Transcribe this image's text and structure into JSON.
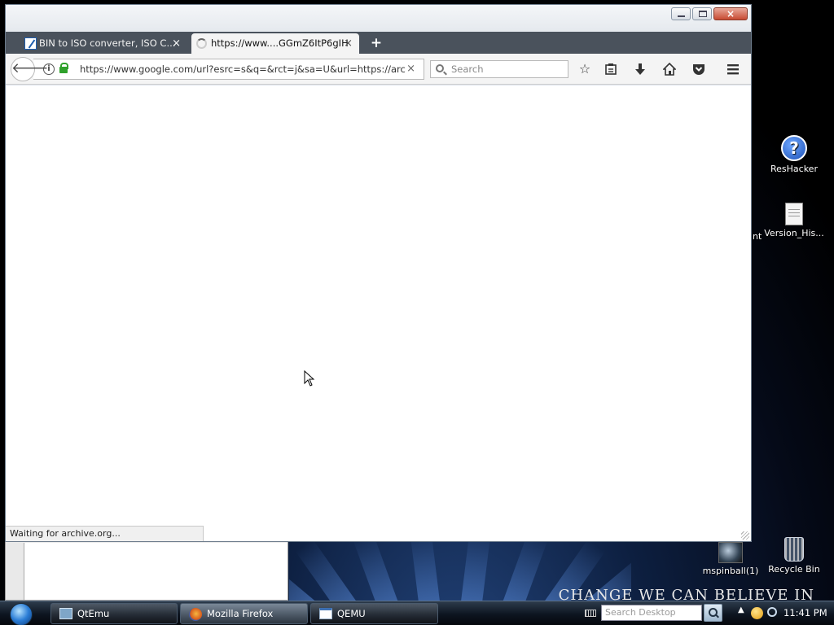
{
  "browser": {
    "tabs": [
      {
        "label": "BIN to ISO converter, ISO C...",
        "close": "×",
        "favicon": "bin-to-iso-favicon-icon"
      },
      {
        "label": "https://www....GGmZ6ItP6gIH",
        "close": "×",
        "favicon": "loading-spinner-icon"
      }
    ],
    "new_tab": "+",
    "window_close": "×",
    "url": "https://www.google.com/url?esrc=s&q=&rct=j&sa=U&url=https://arcl",
    "url_clear": "×",
    "search_placeholder": "Search",
    "status": "Waiting for archive.org...",
    "toolbar_icons": [
      "star-icon",
      "reading-list-icon",
      "download-icon",
      "home-icon",
      "pocket-icon",
      "menu-icon"
    ]
  },
  "desktop": {
    "icons": [
      {
        "label": "ResHacker",
        "icon": "help-icon"
      },
      {
        "label": "Version_His...",
        "icon": "document-icon"
      },
      {
        "label": "mspinball(1)",
        "icon": "pinball-icon"
      },
      {
        "label": "Recycle Bin",
        "icon": "recycle-bin-icon"
      }
    ],
    "left_cut_label": "nt",
    "slogan": "CHANGE WE CAN BELIEVE IN"
  },
  "taskbar": {
    "items": [
      {
        "label": "QtEmu",
        "icon": "qtemu-icon"
      },
      {
        "label": "Mozilla Firefox",
        "icon": "firefox-icon",
        "active": true
      },
      {
        "label": "QEMU",
        "icon": "qemu-icon"
      }
    ],
    "search_placeholder": "Search Desktop",
    "clock": "11:41 PM"
  }
}
